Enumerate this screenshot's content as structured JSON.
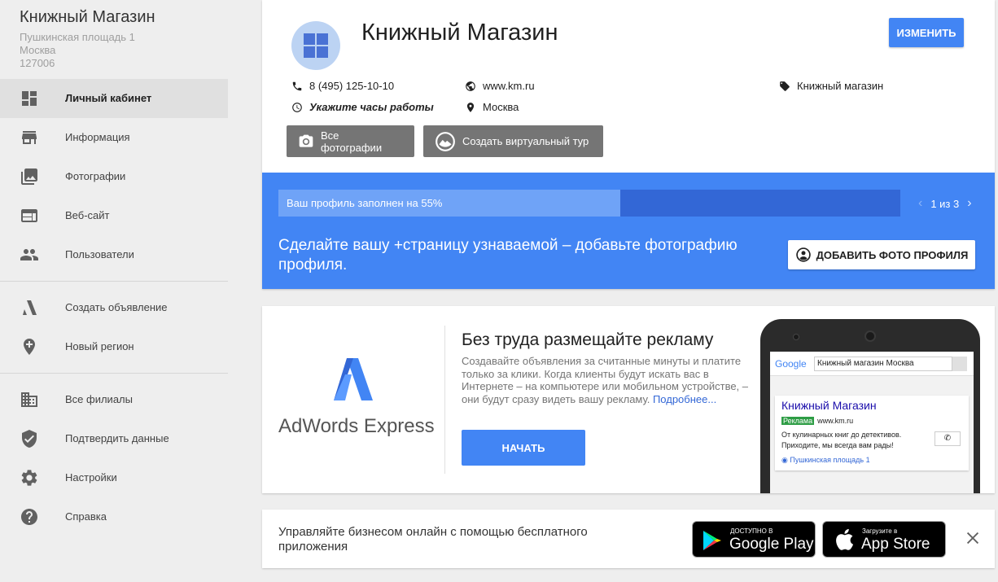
{
  "business": {
    "name": "Книжный Магазин",
    "address_line1": "Пушкинская площадь 1",
    "address_line2": "Москва",
    "postal_code": "127006"
  },
  "sidebar": {
    "items": [
      {
        "label": "Личный кабинет",
        "icon": "dashboard-icon",
        "active": true
      },
      {
        "label": "Информация",
        "icon": "store-icon"
      },
      {
        "label": "Фотографии",
        "icon": "photos-icon"
      },
      {
        "label": "Веб-сайт",
        "icon": "website-icon"
      },
      {
        "label": "Пользователи",
        "icon": "users-icon"
      },
      {
        "label": "Создать объявление",
        "icon": "adwords-icon"
      },
      {
        "label": "Новый регион",
        "icon": "add-location-icon"
      },
      {
        "label": "Все филиалы",
        "icon": "building-icon"
      },
      {
        "label": "Подтвердить данные",
        "icon": "shield-check-icon"
      },
      {
        "label": "Настройки",
        "icon": "gear-icon"
      },
      {
        "label": "Справка",
        "icon": "help-icon"
      }
    ]
  },
  "header": {
    "title": "Книжный Магазин",
    "edit_label": "ИЗМЕНИТЬ",
    "phone": "8 (495) 125-10-10",
    "website": "www.km.ru",
    "category": "Книжный магазин",
    "hours_prompt": "Укажите часы работы",
    "city": "Москва",
    "all_photos_label": "Все фотографии",
    "virtual_tour_label": "Создать виртуальный тур"
  },
  "profile": {
    "progress_text": "Ваш профиль заполнен на 55%",
    "progress_fraction": 0.55,
    "pager": "1 из 3",
    "message": "Сделайте вашу +страницу узнаваемой – добавьте фотографию профиля.",
    "add_photo_label": "ДОБАВИТЬ ФОТО ПРОФИЛЯ"
  },
  "ads": {
    "brand": "AdWords Express",
    "title": "Без труда размещайте рекламу",
    "description": "Создавайте объявления за считанные минуты и платите только за клики. Когда клиенты будут искать вас в Интернете – на компьютере или мобильном устройстве, – они будут сразу видеть вашу рекламу.",
    "more_link": "Подробнее...",
    "start_label": "НАЧАТЬ",
    "phone_mock": {
      "google_logo": "Google",
      "search_query": "Книжный магазин Москва",
      "result_title": "Книжный Магазин",
      "ad_badge": "Реклама",
      "result_url": "www.km.ru",
      "result_text": "От кулинарных книг до детективов. Приходите, мы всегда вам рады!",
      "result_address": "Пушкинская площадь 1"
    }
  },
  "app_banner": {
    "text": "Управляйте бизнесом онлайн с помощью бесплатного приложения",
    "google_play_small": "ДОСТУПНО В",
    "google_play_big": "Google Play",
    "app_store_small": "Загрузите в",
    "app_store_big": "App Store"
  },
  "colors": {
    "accent": "#4285f4",
    "progress_track": "#3367d6",
    "button_gray": "#757575"
  }
}
